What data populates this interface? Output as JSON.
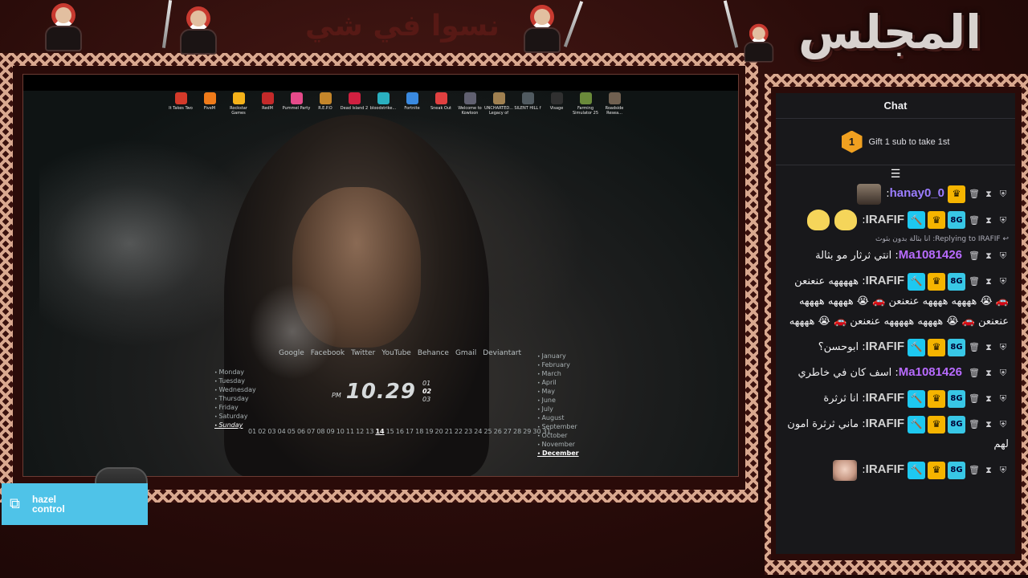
{
  "banner": {
    "title": "المجلس",
    "subtitle": "نسوا في شي"
  },
  "screen": {
    "desktop_icons": [
      {
        "label": "It Takes Two",
        "color": "#d43a2a",
        "icon": "game-icon"
      },
      {
        "label": "FiveM",
        "color": "#ef7b1a",
        "icon": "game-icon"
      },
      {
        "label": "Rockstar Games",
        "color": "#f4b21a",
        "icon": "game-icon"
      },
      {
        "label": "RedM",
        "color": "#c42a2a",
        "icon": "game-icon"
      },
      {
        "label": "Pummel Party",
        "color": "#e64a8a",
        "icon": "game-icon"
      },
      {
        "label": "R.E.P.O",
        "color": "#c4862a",
        "icon": "game-icon"
      },
      {
        "label": "Dead Island 2",
        "color": "#d02040",
        "icon": "game-icon"
      },
      {
        "label": "bloodstrike...",
        "color": "#2ab0c0",
        "icon": "game-icon"
      },
      {
        "label": "Fortnite",
        "color": "#3a8ae0",
        "icon": "game-icon"
      },
      {
        "label": "Sneak Out",
        "color": "#e04040",
        "icon": "game-icon"
      },
      {
        "label": "Welcome to Kowloon",
        "color": "#606070",
        "icon": "game-icon"
      },
      {
        "label": "UNCHARTED... Legacy of",
        "color": "#a08050",
        "icon": "game-icon"
      },
      {
        "label": "SILENT HILL f",
        "color": "#505a60",
        "icon": "game-icon"
      },
      {
        "label": "Visage",
        "color": "#303030",
        "icon": "game-icon"
      },
      {
        "label": "Farming Simulator 25",
        "color": "#6a8a3a",
        "icon": "game-icon"
      },
      {
        "label": "Roadside Resea...",
        "color": "#706050",
        "icon": "game-icon"
      }
    ],
    "links": [
      "Google",
      "Facebook",
      "Twitter",
      "YouTube",
      "Behance",
      "Gmail",
      "Deviantart"
    ],
    "days": [
      "Monday",
      "Tuesday",
      "Wednesday",
      "Thursday",
      "Friday",
      "Saturday",
      "Sunday"
    ],
    "active_day": "Sunday",
    "months": [
      "January",
      "February",
      "March",
      "April",
      "May",
      "June",
      "July",
      "August",
      "September",
      "October",
      "November",
      "December"
    ],
    "active_month": "December",
    "clock": {
      "ampm": "PM",
      "time": "10.29",
      "secs": [
        "01",
        "02",
        "03"
      ],
      "cur_sec": "02"
    },
    "dates": [
      "01",
      "02",
      "03",
      "04",
      "05",
      "06",
      "07",
      "08",
      "09",
      "10",
      "11",
      "12",
      "13",
      "14",
      "15",
      "16",
      "17",
      "18",
      "19",
      "20",
      "21",
      "22",
      "23",
      "24",
      "25",
      "26",
      "27",
      "28",
      "29",
      "30",
      "31"
    ],
    "active_date": "14"
  },
  "hazel": {
    "line1": "hazel",
    "line2": "control"
  },
  "chat": {
    "header": "Chat",
    "gift_rank": "1",
    "gift_text": "Gift 1 sub to take 1st",
    "messages": [
      {
        "user": "hanay0_0",
        "text": "",
        "badges": [
          "crown"
        ],
        "emote": "face",
        "color": "#9b7dff"
      },
      {
        "user": "IRAFIF",
        "text": "",
        "badges": [
          "mod",
          "crown",
          "vip"
        ],
        "emote": "hands",
        "color": "#d2d2d2"
      },
      {
        "reply": "Replying to IRAFIF: انا بثالة بدون بثوث",
        "user": "Ma1081426",
        "text": "انتي ثرثار مو بثالة",
        "badges": [],
        "color": "#b86bff"
      },
      {
        "user": "IRAFIF",
        "text": "هههههه عنعنعن 🚗 😭 ههههه ههههه عنعنعن 🚗 😭 ههههه ههههه عنعنعن 🚗 😭 ههههه هههههه عنعنعن 🚗 😭 ههههه",
        "badges": [
          "mod",
          "crown",
          "vip"
        ],
        "color": "#d2d2d2"
      },
      {
        "user": "IRAFIF",
        "text": "ابوحسن؟",
        "badges": [
          "mod",
          "crown",
          "vip"
        ],
        "color": "#d2d2d2"
      },
      {
        "user": "Ma1081426",
        "text": "اسف كان في خاطري",
        "badges": [],
        "color": "#b86bff"
      },
      {
        "user": "IRAFIF",
        "text": "انا ثرثرة",
        "badges": [
          "mod",
          "crown",
          "vip"
        ],
        "color": "#d2d2d2"
      },
      {
        "user": "IRAFIF",
        "text": "ماني ثرثرة امون لهم",
        "badges": [
          "mod",
          "crown",
          "vip"
        ],
        "color": "#d2d2d2"
      },
      {
        "user": "IRAFIF",
        "text": "",
        "badges": [
          "mod",
          "crown",
          "vip"
        ],
        "emote": "baby",
        "color": "#d2d2d2"
      }
    ]
  }
}
